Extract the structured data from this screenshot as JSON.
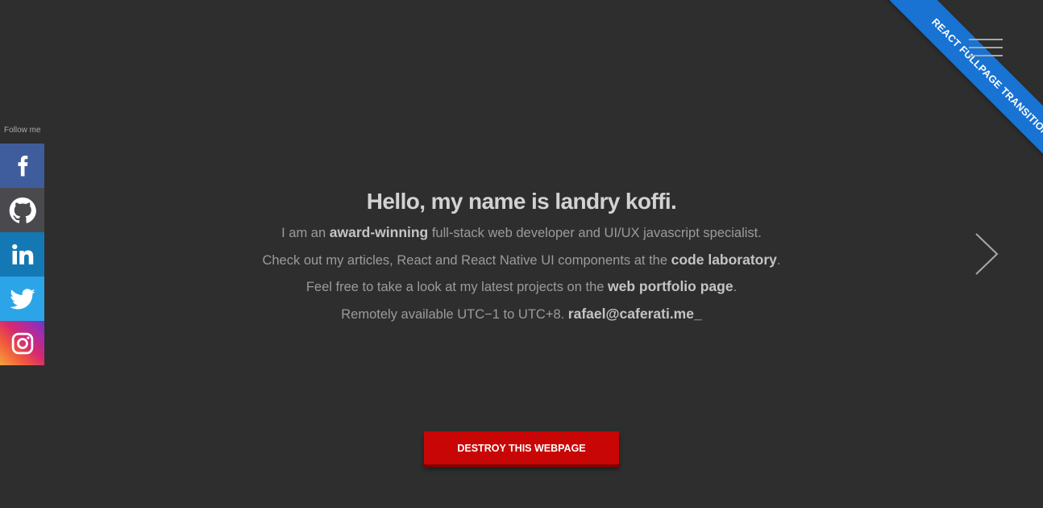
{
  "social": {
    "follow_label": "Follow me",
    "items": [
      {
        "name": "facebook",
        "color": "#3f5d9c"
      },
      {
        "name": "github",
        "color": "#4a4a4e"
      },
      {
        "name": "linkedin",
        "color": "#1478b4"
      },
      {
        "name": "twitter",
        "color": "#2ba5e8"
      },
      {
        "name": "instagram",
        "color": "#d7296f"
      }
    ]
  },
  "ribbon": {
    "label": "REACT FULLPAGE TRANSITIONS",
    "color": "#1873d3"
  },
  "menu": {
    "icon": "hamburger-icon"
  },
  "navigation": {
    "next_icon": "chevron-right-icon"
  },
  "hero": {
    "title": "Hello, my name is landry koffi.",
    "line1": {
      "pre": "I am an ",
      "bold": "award-winning",
      "post": " full-stack web developer and UI/UX javascript specialist."
    },
    "line2": {
      "pre": "Check out my articles, React and React Native UI components at the ",
      "bold": "code laboratory",
      "post": "."
    },
    "line3": {
      "pre": "Feel free to take a look at my latest projects on the ",
      "bold": "web portfolio page",
      "post": "."
    },
    "line4": {
      "pre": "Remotely available UTC−1 to UTC+8. ",
      "bold": "rafael@caferati.me_",
      "post": ""
    }
  },
  "action": {
    "button_label": "DESTROY THIS WEBPAGE",
    "button_color": "#c80606"
  },
  "colors": {
    "background": "#2e2e2e"
  }
}
